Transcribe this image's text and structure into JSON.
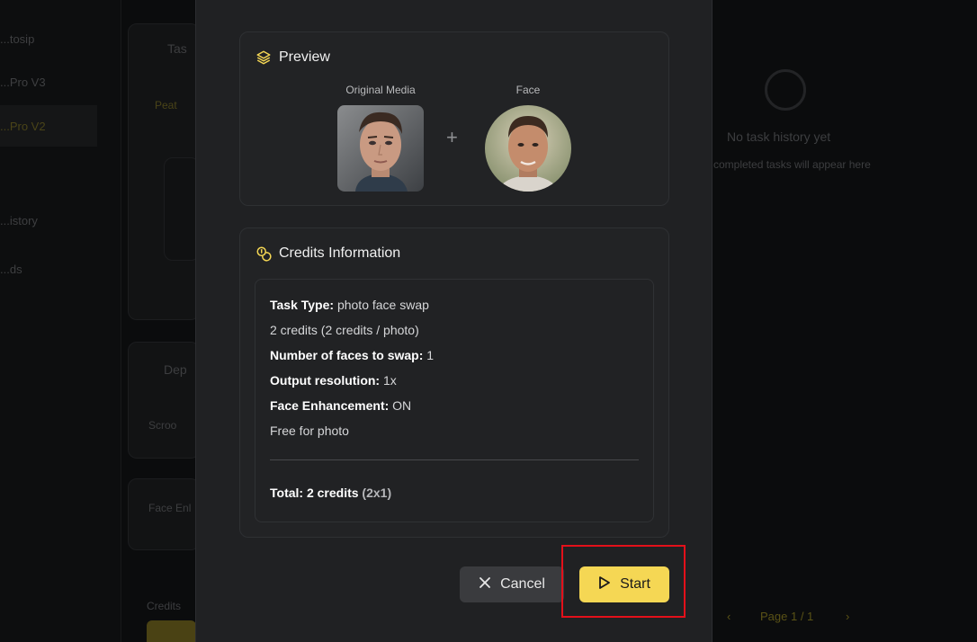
{
  "background": {
    "sidebar_items": [
      "...tosip",
      "...Pro V3",
      "...Pro V2",
      "...istory",
      "...ds"
    ],
    "panel_title": "Tas",
    "panel_tab": "Peat",
    "panel2_title": "Dep",
    "panel2_text": "Scroo",
    "panel3_text": "Face Enl",
    "credits_label": "Credits",
    "history_empty_title": "No task history yet",
    "history_empty_subtitle": "completed tasks will appear here",
    "pager": "Page 1 / 1"
  },
  "preview": {
    "title": "Preview",
    "original_label": "Original Media",
    "face_label": "Face",
    "plus": "+"
  },
  "credits": {
    "title": "Credits Information",
    "task_type_label": "Task Type:",
    "task_type_value": " photo face swap",
    "credits_rate": "2 credits (2 credits / photo)",
    "faces_label": "Number of faces to swap:",
    "faces_value": " 1",
    "resolution_label": "Output resolution:",
    "resolution_value": " 1x",
    "enhancement_label": "Face Enhancement:",
    "enhancement_value": " ON",
    "free_note": "Free for photo",
    "total_label": "Total: 2 credits",
    "total_detail": " (2x1)"
  },
  "actions": {
    "cancel_label": "Cancel",
    "start_label": "Start"
  },
  "colors": {
    "accent": "#f5d754",
    "modal_bg": "#202123",
    "highlight": "#e3101a"
  },
  "icons": {
    "preview": "layers-icon",
    "credits": "coins-icon",
    "cancel": "close-icon",
    "start": "play-icon"
  }
}
